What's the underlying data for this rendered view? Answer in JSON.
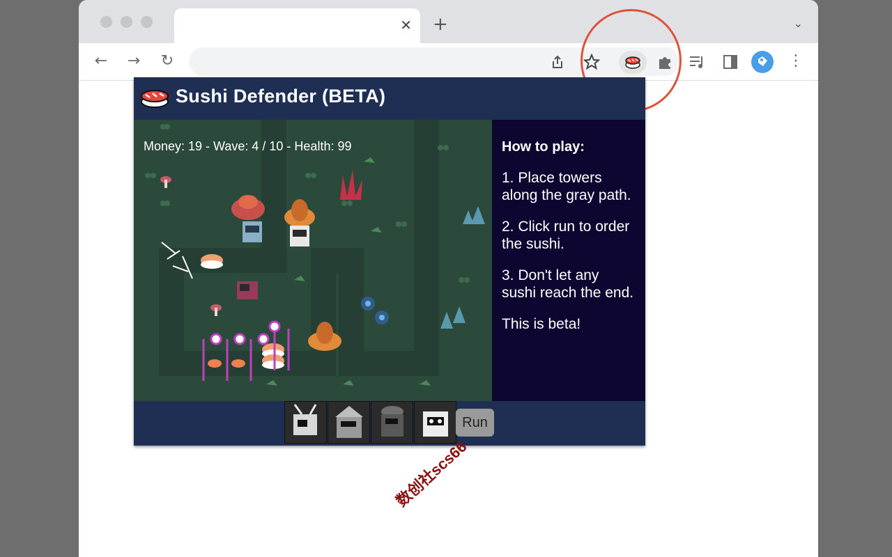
{
  "browser": {
    "tab": {
      "title": "",
      "close_glyph": "✕"
    },
    "new_tab_glyph": "+",
    "tab_menu_glyph": "⌄",
    "nav": {
      "back": "←",
      "forward": "→",
      "reload": "↻"
    },
    "toolbar_icons": [
      "share-icon",
      "star-icon",
      "sushi-extension-icon",
      "puzzle-icon",
      "reading-list-icon",
      "side-panel-icon",
      "profile-avatar",
      "kebab-menu-icon"
    ],
    "highlight_color": "#e0513b"
  },
  "popup": {
    "title": "Sushi Defender (BETA)",
    "stats": "Money: 19 - Wave: 4 / 10 - Health: 99",
    "instructions": {
      "heading": "How to play:",
      "steps": [
        "1. Place towers along the gray path.",
        "2. Click run to order the sushi.",
        "3. Don't let any sushi reach the end."
      ],
      "note": "This is beta!"
    },
    "towers": [
      "tower-1",
      "tower-2",
      "tower-3",
      "tower-4"
    ],
    "run_label": "Run"
  },
  "watermark": "数创社scs66"
}
